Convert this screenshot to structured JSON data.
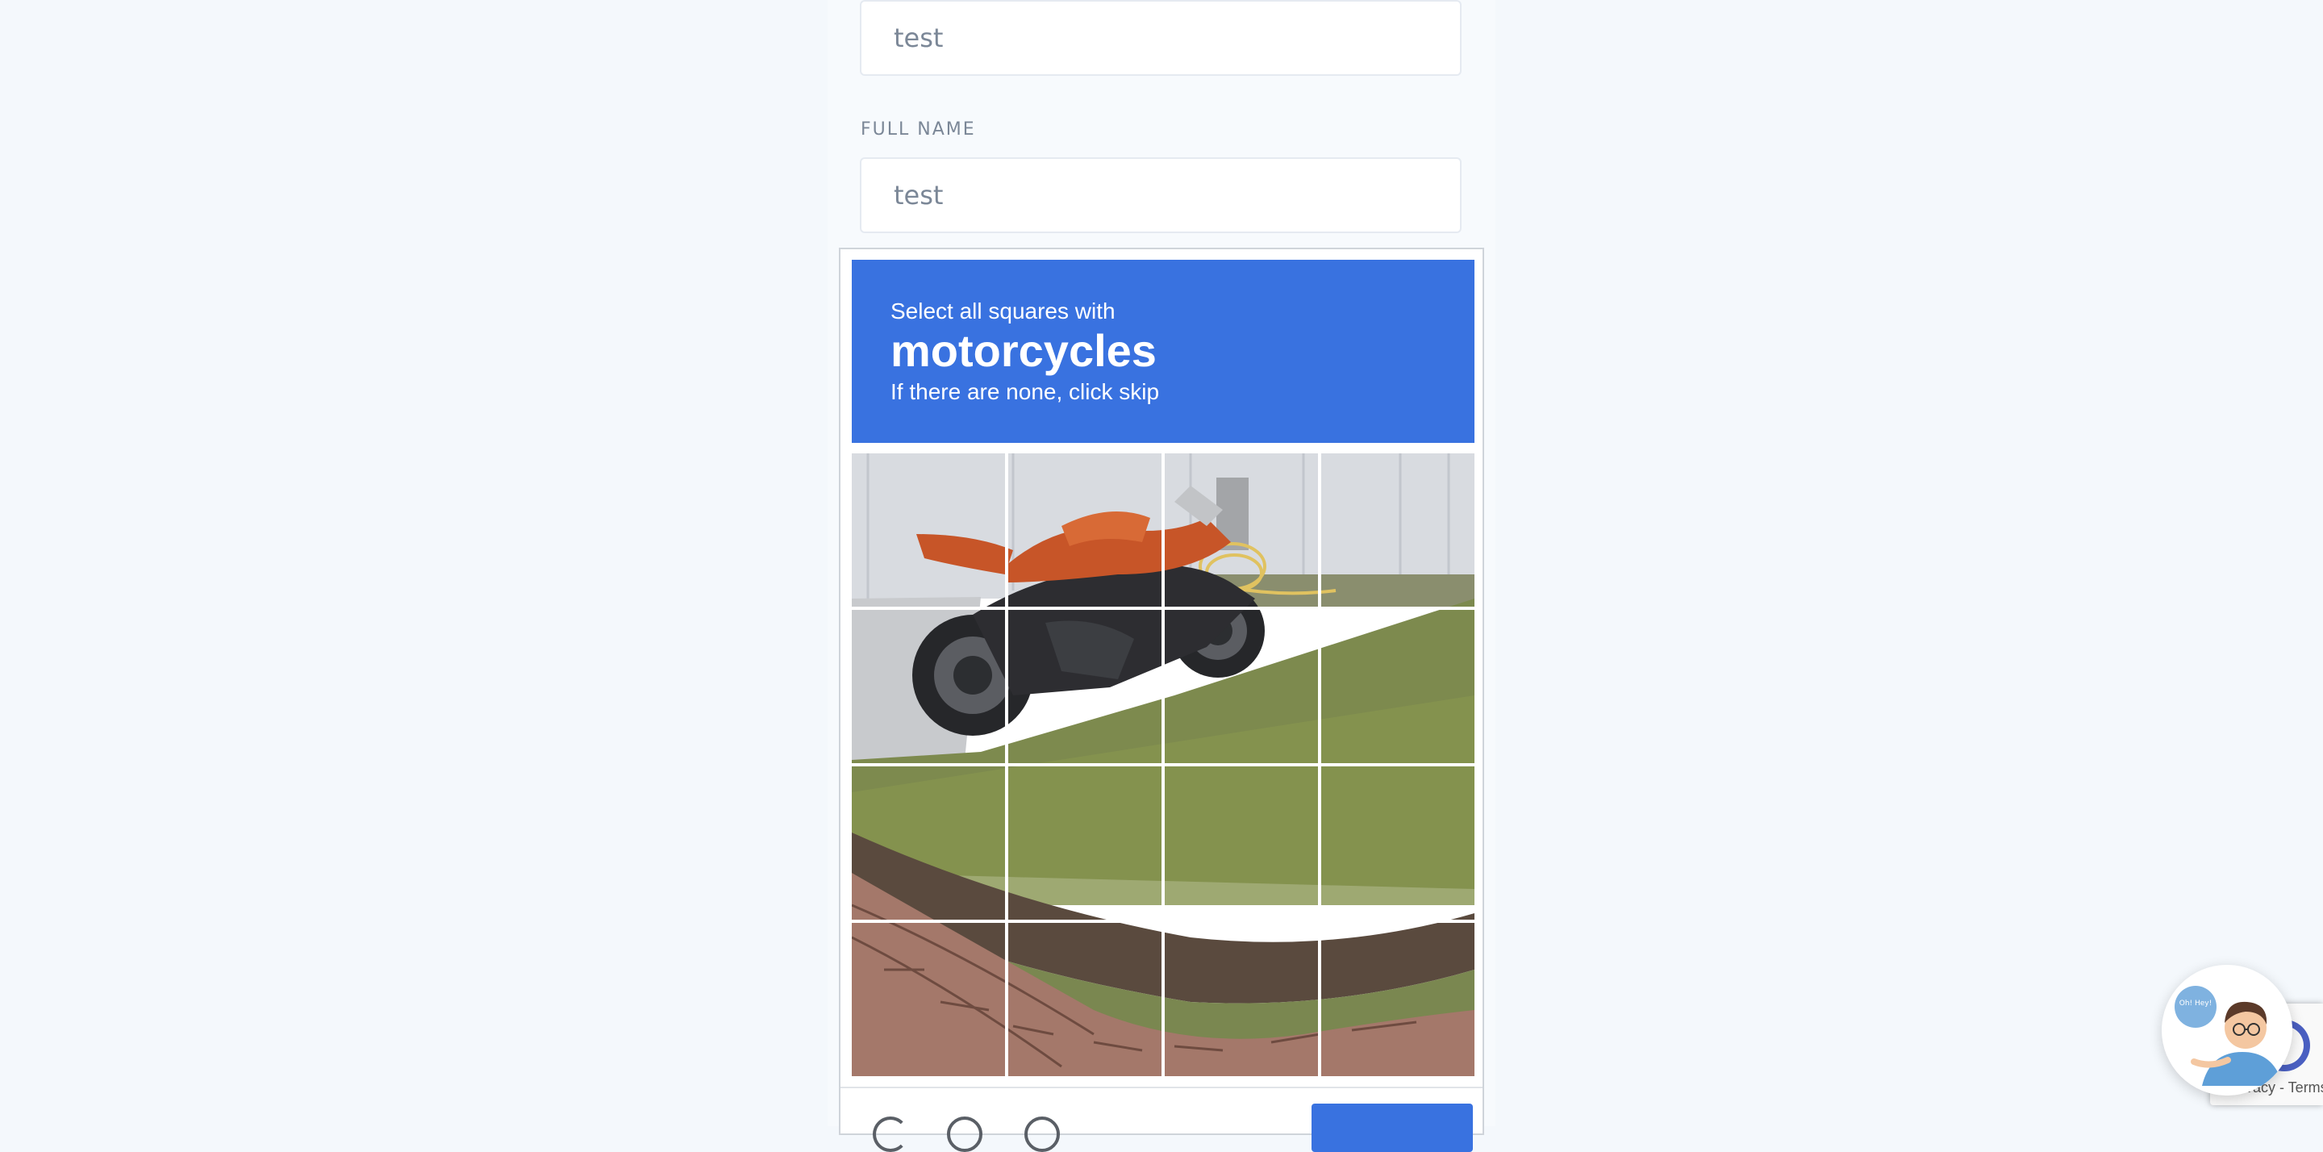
{
  "form": {
    "field1_value": "test",
    "fullname_label": "FULL NAME",
    "fullname_value": "test"
  },
  "captcha": {
    "instruction_line1": "Select all squares with",
    "target": "motorcycles",
    "instruction_line3": "If there are none, click skip",
    "tiles": [
      "1",
      "2",
      "3",
      "4",
      "5",
      "6",
      "7",
      "8",
      "9",
      "10",
      "11",
      "12",
      "13",
      "14",
      "15",
      "16"
    ],
    "header_color": "#3972e0",
    "footer_icons": [
      "reload-icon",
      "audio-icon",
      "info-icon"
    ],
    "verify_label": ""
  },
  "recaptcha_badge": {
    "text": "Privacy - Terms"
  },
  "chat_widget": {
    "bubble_text": "Oh! Hey!",
    "icon": "assistant-avatar-icon"
  }
}
